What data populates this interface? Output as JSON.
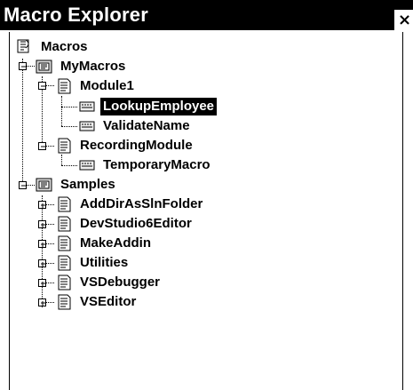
{
  "window": {
    "title": "Macro Explorer",
    "close_glyph": "×"
  },
  "tree": {
    "root": {
      "label": "Macros",
      "icon": "macros-root-icon"
    },
    "mymacros": {
      "label": "MyMacros",
      "expanded": true,
      "icon": "project-icon",
      "modules": [
        {
          "label": "Module1",
          "expanded": true,
          "icon": "module-icon",
          "macros": [
            {
              "label": "LookupEmployee",
              "selected": true,
              "icon": "macro-icon"
            },
            {
              "label": "ValidateName",
              "selected": false,
              "icon": "macro-icon"
            }
          ]
        },
        {
          "label": "RecordingModule",
          "expanded": true,
          "icon": "module-icon",
          "macros": [
            {
              "label": "TemporaryMacro",
              "selected": false,
              "icon": "macro-icon"
            }
          ]
        }
      ]
    },
    "samples": {
      "label": "Samples",
      "expanded": true,
      "icon": "project-icon",
      "modules": [
        {
          "label": "AddDirAsSlnFolder",
          "expanded": false
        },
        {
          "label": "DevStudio6Editor",
          "expanded": false
        },
        {
          "label": "MakeAddin",
          "expanded": false
        },
        {
          "label": "Utilities",
          "expanded": false
        },
        {
          "label": "VSDebugger",
          "expanded": false
        },
        {
          "label": "VSEditor",
          "expanded": false
        }
      ]
    }
  },
  "colors": {
    "title_bg": "#000000",
    "title_fg": "#ffffff",
    "selection_bg": "#000000",
    "selection_fg": "#ffffff"
  }
}
